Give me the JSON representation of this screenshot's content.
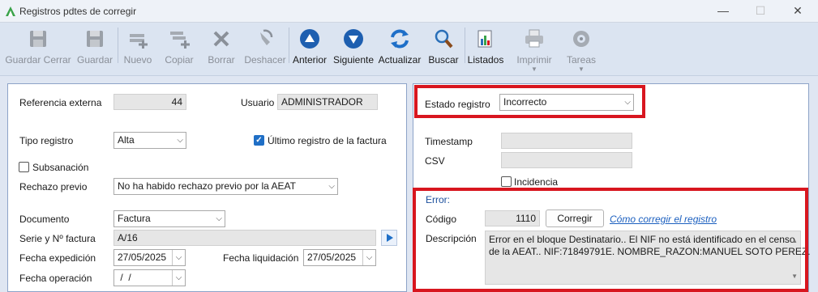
{
  "window": {
    "title": "Registros pdtes de corregir"
  },
  "toolbar": {
    "guardar_cerrar": "Guardar Cerrar",
    "guardar": "Guardar",
    "nuevo": "Nuevo",
    "copiar": "Copiar",
    "borrar": "Borrar",
    "deshacer": "Deshacer",
    "anterior": "Anterior",
    "siguiente": "Siguiente",
    "actualizar": "Actualizar",
    "buscar": "Buscar",
    "listados": "Listados",
    "imprimir": "Imprimir",
    "tareas": "Tareas"
  },
  "left": {
    "ref_label": "Referencia externa",
    "ref_value": "44",
    "usuario_label": "Usuario",
    "usuario_value": "ADMINISTRADOR",
    "tipo_label": "Tipo registro",
    "tipo_value": "Alta",
    "ultimo_label": "Último registro de la factura",
    "ultimo_checked": true,
    "subsanacion_label": "Subsanación",
    "subsanacion_checked": false,
    "rechazo_label": "Rechazo previo",
    "rechazo_value": "No ha habido rechazo previo por la AEAT",
    "documento_label": "Documento",
    "documento_value": "Factura",
    "serie_label": "Serie y Nº factura",
    "serie_value": "A/16",
    "fexp_label": "Fecha expedición",
    "fexp_value": "27/05/2025",
    "fliq_label": "Fecha liquidación",
    "fliq_value": "27/05/2025",
    "fop_label": "Fecha operación",
    "fop_value": " /  /"
  },
  "right": {
    "estado_label": "Estado registro",
    "estado_value": "Incorrecto",
    "timestamp_label": "Timestamp",
    "timestamp_value": "",
    "csv_label": "CSV",
    "csv_value": "",
    "incidencia_label": "Incidencia",
    "incidencia_checked": false,
    "error_title": "Error:",
    "codigo_label": "Código",
    "codigo_value": "1110",
    "corregir_button": "Corregir",
    "como_link": "Cómo corregir el registro",
    "descripcion_label": "Descripción",
    "descripcion_line1": "Error en el bloque Destinatario.. El NIF no está identificado en el censo",
    "descripcion_line2": "de la AEAT.. NIF:71849791E. NOMBRE_RAZON:MANUEL SOTO PEREZ."
  },
  "colors": {
    "highlight": "#d8161f",
    "accent": "#1f6fc6",
    "link": "#1b5fbf"
  }
}
